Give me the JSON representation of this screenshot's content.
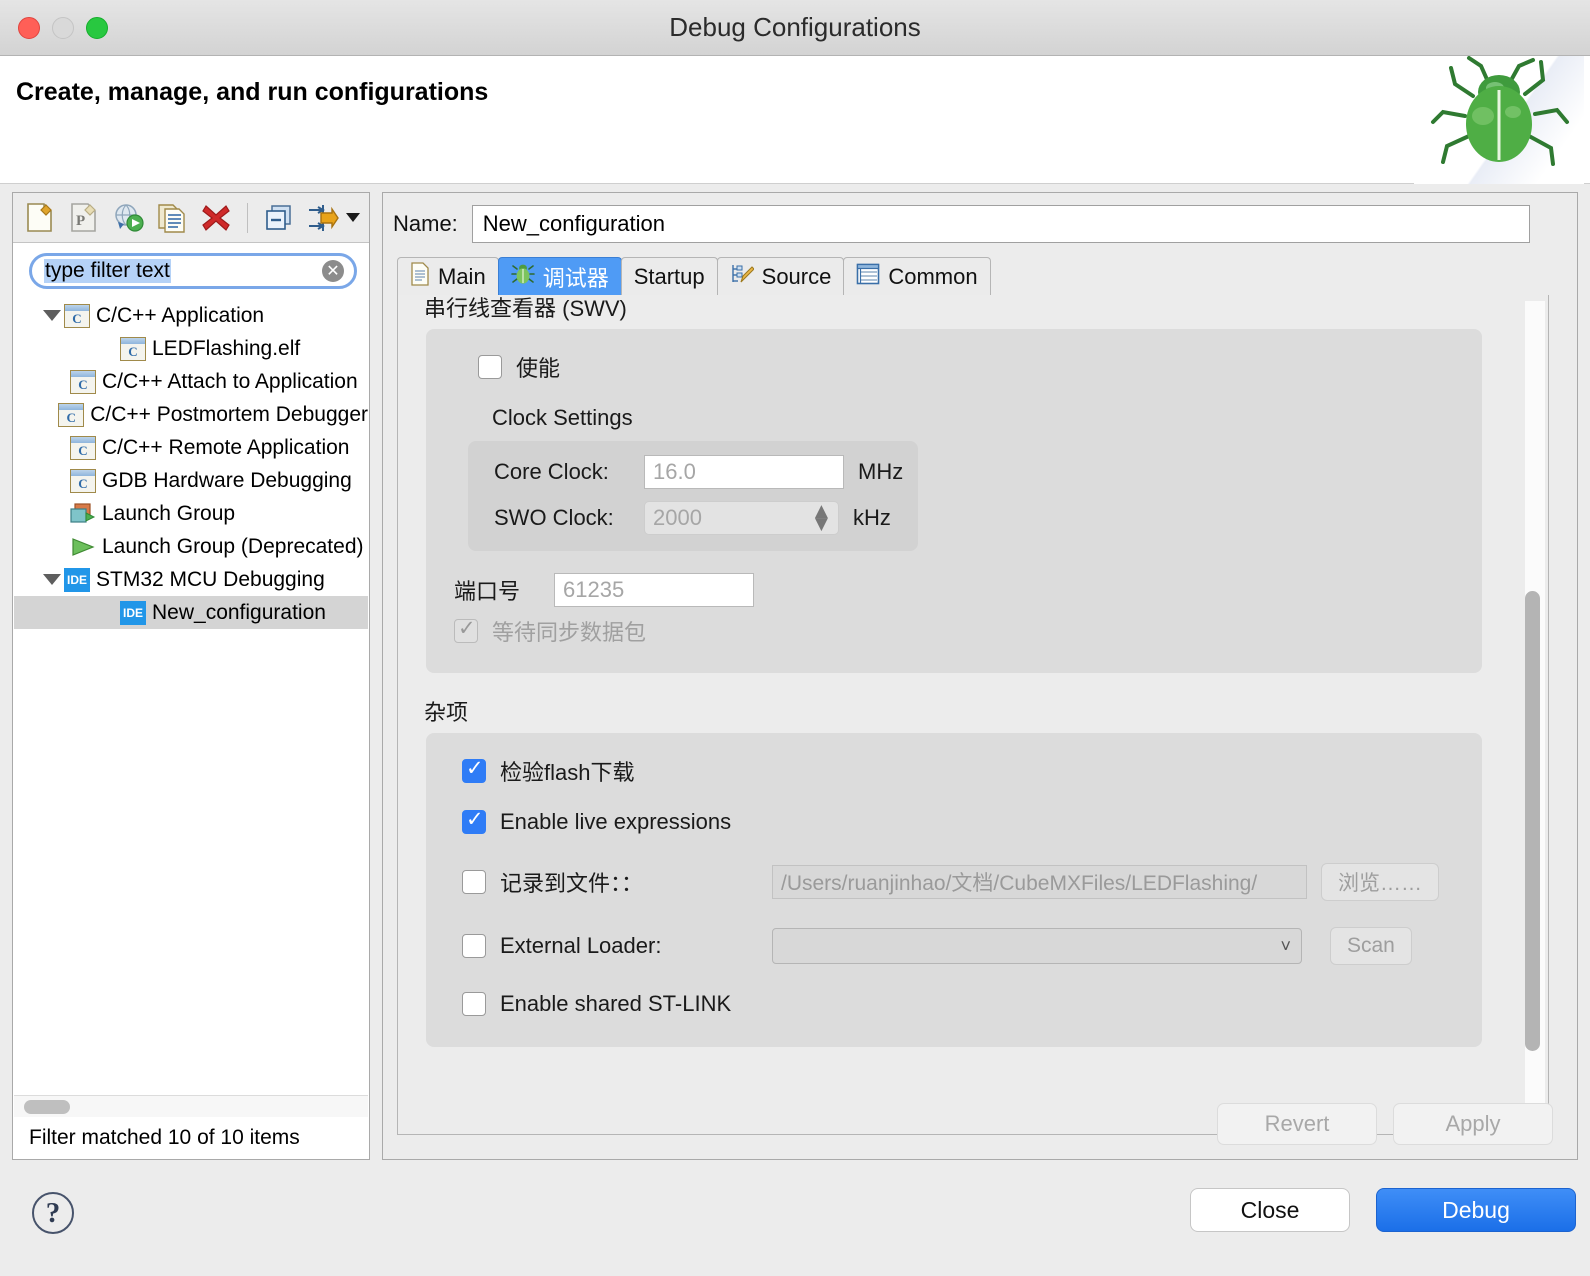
{
  "window": {
    "title": "Debug Configurations",
    "traffic_lights": [
      "close",
      "minimize",
      "zoom"
    ]
  },
  "banner": {
    "title": "Create, manage, and run configurations",
    "icon": "bug-icon"
  },
  "toolbar": {
    "buttons": [
      {
        "name": "new-configuration-icon",
        "label": "New launch configuration"
      },
      {
        "name": "new-prototype-icon",
        "label": "New prototype"
      },
      {
        "name": "new-launch-group-icon",
        "label": "New launch group"
      },
      {
        "name": "duplicate-icon",
        "label": "Duplicate"
      },
      {
        "name": "delete-icon",
        "label": "Delete"
      },
      {
        "name": "collapse-all-icon",
        "label": "Collapse All"
      },
      {
        "name": "filter-icon",
        "label": "Filter"
      }
    ]
  },
  "filter": {
    "value": "type filter text",
    "clear_glyph": "✕",
    "status": "Filter matched 10 of 10 items"
  },
  "tree": {
    "items": [
      {
        "label": "C/C++ Application",
        "icon": "c-app-icon",
        "indent": 0,
        "twisty": "expanded",
        "selected": false
      },
      {
        "label": "LEDFlashing.elf",
        "icon": "c-app-icon",
        "indent": 1,
        "twisty": "none",
        "selected": false
      },
      {
        "label": "C/C++ Attach to Application",
        "icon": "c-app-icon",
        "indent": 0,
        "twisty": "none",
        "selected": false
      },
      {
        "label": "C/C++ Postmortem Debugger",
        "icon": "c-app-icon",
        "indent": 0,
        "twisty": "none",
        "selected": false
      },
      {
        "label": "C/C++ Remote Application",
        "icon": "c-app-icon",
        "indent": 0,
        "twisty": "none",
        "selected": false
      },
      {
        "label": "GDB Hardware Debugging",
        "icon": "c-app-icon",
        "indent": 0,
        "twisty": "none",
        "selected": false
      },
      {
        "label": "Launch Group",
        "icon": "launch-group-icon",
        "indent": 0,
        "twisty": "none",
        "selected": false
      },
      {
        "label": "Launch Group (Deprecated)",
        "icon": "launch-group-deprecated-icon",
        "indent": 0,
        "twisty": "none",
        "selected": false
      },
      {
        "label": "STM32 MCU Debugging",
        "icon": "ide-icon",
        "indent": 0,
        "twisty": "expanded",
        "selected": false
      },
      {
        "label": "New_configuration",
        "icon": "ide-icon",
        "indent": 1,
        "twisty": "none",
        "selected": true
      }
    ]
  },
  "config": {
    "name_label": "Name:",
    "name_value": "New_configuration",
    "tabs": [
      {
        "label": "Main",
        "icon": "document-icon",
        "active": false
      },
      {
        "label": "调试器",
        "icon": "debugger-bug-icon",
        "active": true
      },
      {
        "label": "Startup",
        "icon": "none",
        "active": false
      },
      {
        "label": "Source",
        "icon": "source-pencil-icon",
        "active": false
      },
      {
        "label": "Common",
        "icon": "table-icon",
        "active": false
      }
    ]
  },
  "swv": {
    "section_title": "串行线查看器 (SWV)",
    "enable": {
      "label": "使能",
      "checked": false
    },
    "clock_settings_title": "Clock Settings",
    "core_clock": {
      "label": "Core Clock:",
      "value": "16.0",
      "unit": "MHz"
    },
    "swo_clock": {
      "label": "SWO Clock:",
      "value": "2000",
      "unit": "kHz"
    },
    "port": {
      "label": "端口号",
      "value": "61235"
    },
    "wait_sync": {
      "label": "等待同步数据包",
      "checked": true,
      "disabled": true
    }
  },
  "misc": {
    "section_title": "杂项",
    "verify_flash": {
      "label": "检验flash下载",
      "checked": true
    },
    "live_expressions": {
      "label": "Enable live expressions",
      "checked": true
    },
    "log_to_file": {
      "label": "记录到文件：：",
      "checked": false,
      "path": "/Users/ruanjinhao/文档/CubeMXFiles/LEDFlashing/",
      "browse_label": "浏览……"
    },
    "external_loader": {
      "label": "External Loader:",
      "checked": false,
      "value": "",
      "scan_label": "Scan"
    },
    "shared_stlink": {
      "label": "Enable shared ST-LINK",
      "checked": false
    }
  },
  "actions": {
    "revert": "Revert",
    "apply": "Apply",
    "close": "Close",
    "debug": "Debug",
    "help": "?"
  },
  "colors": {
    "accent_blue": "#2f7cf6",
    "tab_active": "#4f9bf5",
    "debug_button": "#1b6fe8",
    "selection_gray": "#d4d4d4",
    "panel_bg": "#ececec"
  }
}
